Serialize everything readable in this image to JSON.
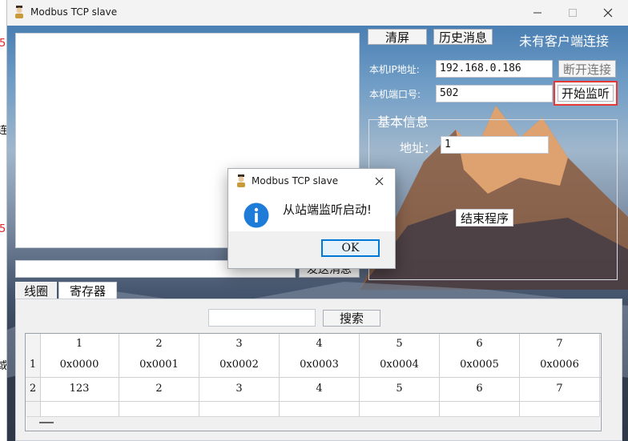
{
  "background_text": {
    "marks": [
      "5",
      "连",
      "5",
      "或"
    ]
  },
  "window": {
    "title": "Modbus TCP slave",
    "icon": "app-person-icon",
    "controls": {
      "minimize": "minimize-icon",
      "maximize": "maximize-icon",
      "close": "close-icon"
    }
  },
  "left": {
    "send_button_label": "发送消息"
  },
  "header": {
    "clear_label": "清屏",
    "history_label": "历史消息",
    "status_text": "未有客户端连接"
  },
  "network": {
    "ip_label": "本机IP地址:",
    "ip_value": "192.168.0.186",
    "disconnect_label": "断开连接",
    "port_label": "本机端口号:",
    "port_value": "502",
    "listen_label": "开始监听"
  },
  "basic_info": {
    "group_title": "基本信息",
    "address_label": "地址：",
    "address_value": "1",
    "end_program_label": "结束程序"
  },
  "tabs": [
    {
      "label": "线圈"
    },
    {
      "label": "寄存器"
    }
  ],
  "search": {
    "button_label": "搜索"
  },
  "table": {
    "columns": [
      "1",
      "2",
      "3",
      "4",
      "5",
      "6",
      "7"
    ],
    "rows": [
      {
        "header": "1",
        "cells": [
          "0x0000",
          "0x0001",
          "0x0002",
          "0x0003",
          "0x0004",
          "0x0005",
          "0x0006"
        ]
      },
      {
        "header": "2",
        "cells": [
          "123",
          "2",
          "3",
          "4",
          "5",
          "6",
          "7"
        ]
      }
    ]
  },
  "dialog": {
    "title": "Modbus TCP slave",
    "message": "从站端监听启动!",
    "ok_label": "OK",
    "icon": "info-icon"
  },
  "colors": {
    "highlight": "#e53935",
    "dialog_accent": "#0078d7"
  }
}
